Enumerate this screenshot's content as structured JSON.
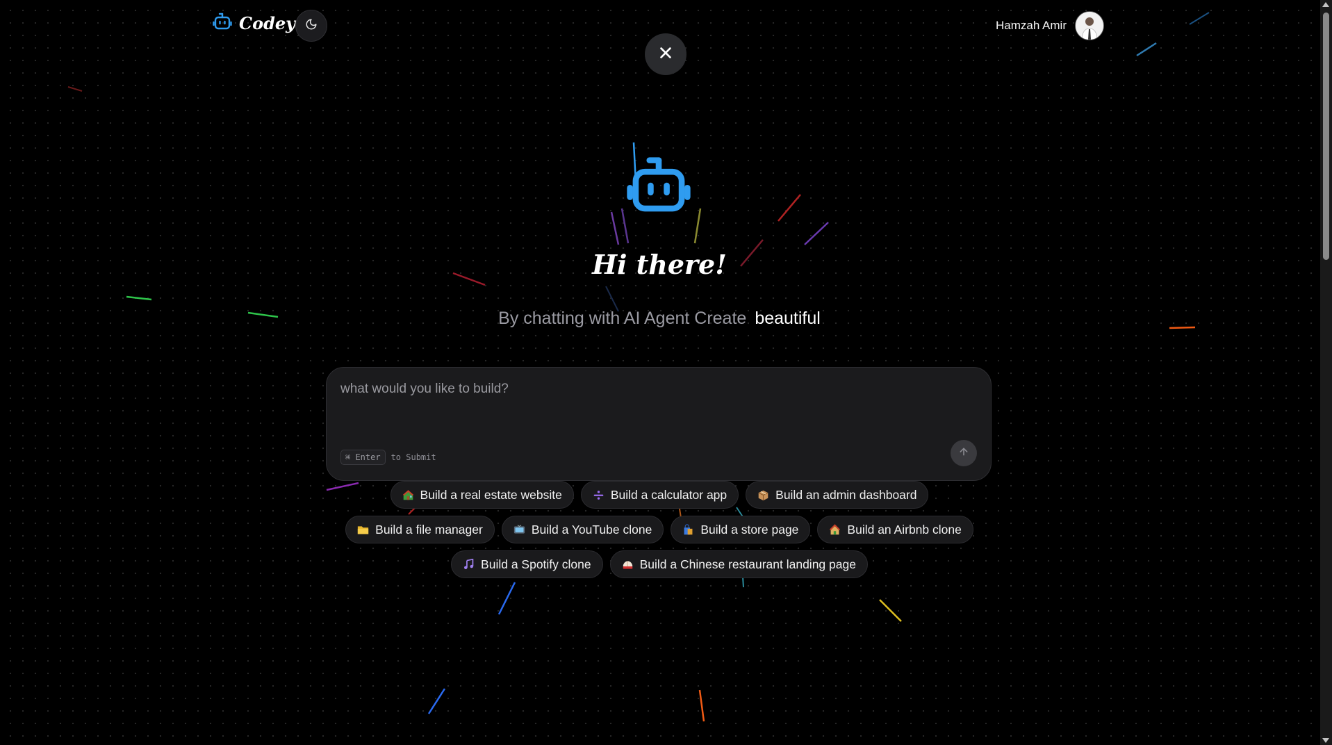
{
  "header": {
    "brand_name": "Codey",
    "user_name": "Hamzah Amir"
  },
  "hero": {
    "title": "Hi there!",
    "subtitle_prefix": "By chatting with AI Agent Create",
    "subtitle_highlight": "beautiful"
  },
  "prompt": {
    "placeholder": "what would you like to build?",
    "shortcut_key": "⌘ Enter",
    "shortcut_text": "to Submit"
  },
  "suggestions": [
    {
      "icon": "house-icon",
      "label": "Build a real estate website"
    },
    {
      "icon": "calculator-icon",
      "label": "Build a calculator app"
    },
    {
      "icon": "package-icon",
      "label": "Build an admin dashboard"
    },
    {
      "icon": "folder-icon",
      "label": "Build a file manager"
    },
    {
      "icon": "tv-icon",
      "label": "Build a YouTube clone"
    },
    {
      "icon": "shopping-bag-icon",
      "label": "Build a store page"
    },
    {
      "icon": "home-icon",
      "label": "Build an Airbnb clone"
    },
    {
      "icon": "music-note-icon",
      "label": "Build a Spotify clone"
    },
    {
      "icon": "dumpling-icon",
      "label": "Build a Chinese restaurant landing page"
    }
  ],
  "colors": {
    "accent": "#2f9cf0",
    "background": "#000000",
    "card": "#1b1b1d"
  }
}
